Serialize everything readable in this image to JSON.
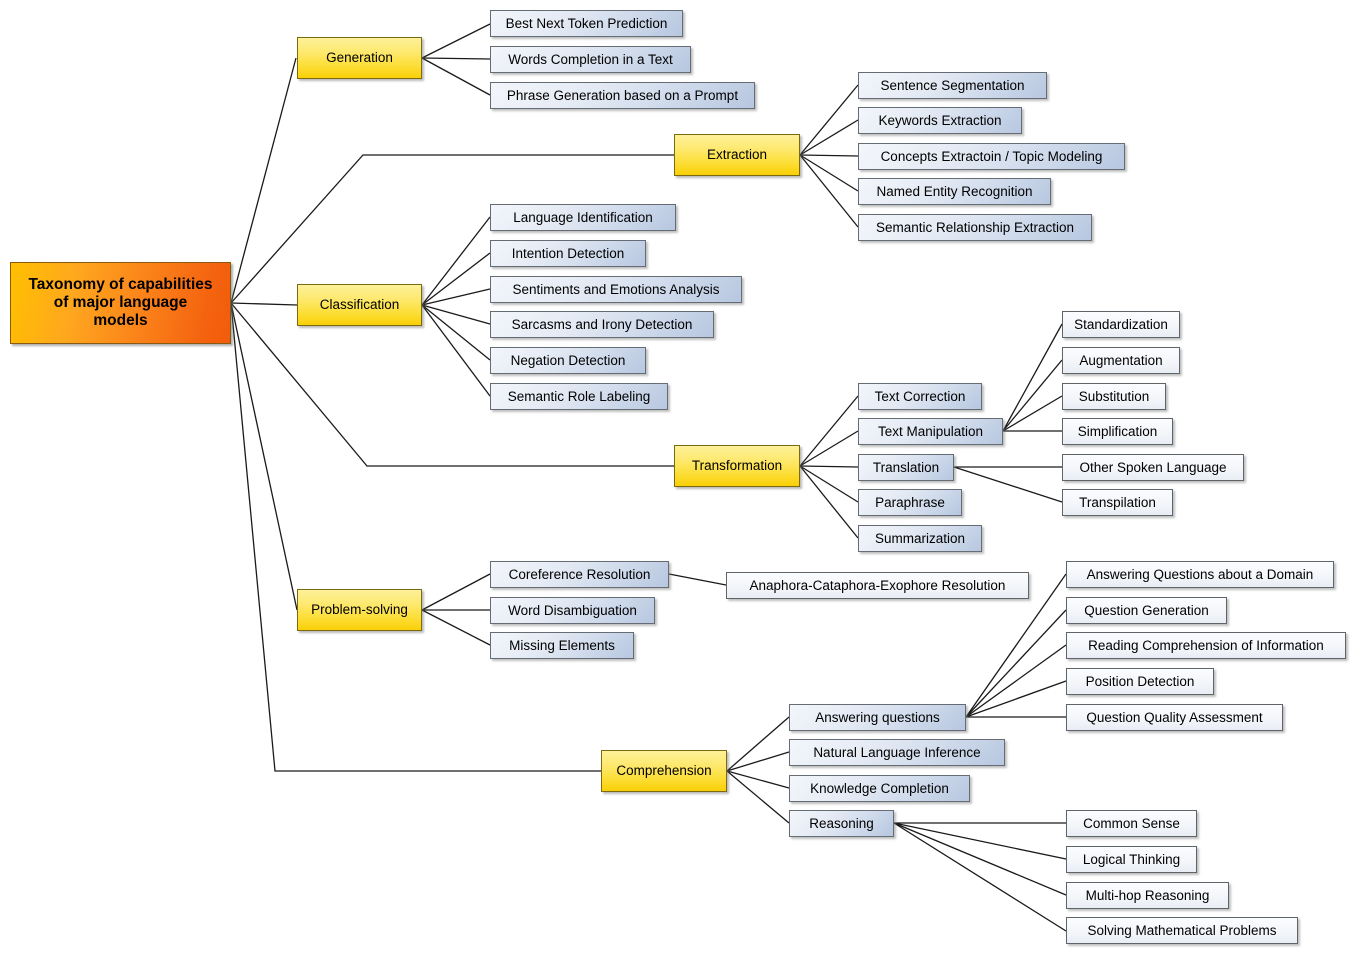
{
  "diagram": {
    "type": "mind-map",
    "title": "Taxonomy of capabilities of major language models",
    "background": "#ffffff",
    "colors": {
      "root_fill_left": "#ffc000",
      "root_fill_right": "#f25c0a",
      "category_fill": "#fcdc2e",
      "leaf_fill": "#ccd8ea",
      "sub_fill": "#f4f6fa",
      "edge": "#1a1a1a",
      "text": "#000000"
    }
  },
  "root": {
    "label": "Taxonomy of capabilities\nof major language\nmodels",
    "line1": "Taxonomy of capabilities",
    "line2": "of major language",
    "line3": "models"
  },
  "branches": [
    {
      "id": "generation",
      "label": "Generation",
      "children": [
        {
          "label": "Best Next Token Prediction"
        },
        {
          "label": "Words Completion in a Text"
        },
        {
          "label": "Phrase Generation based on a Prompt"
        }
      ]
    },
    {
      "id": "extraction",
      "label": "Extraction",
      "children": [
        {
          "label": "Sentence Segmentation"
        },
        {
          "label": "Keywords Extraction"
        },
        {
          "label": "Concepts Extractoin / Topic Modeling"
        },
        {
          "label": "Named Entity Recognition"
        },
        {
          "label": "Semantic Relationship Extraction"
        }
      ]
    },
    {
      "id": "classification",
      "label": "Classification",
      "children": [
        {
          "label": "Language Identification"
        },
        {
          "label": "Intention Detection"
        },
        {
          "label": "Sentiments and Emotions Analysis"
        },
        {
          "label": "Sarcasms and Irony Detection"
        },
        {
          "label": "Negation Detection"
        },
        {
          "label": "Semantic Role Labeling"
        }
      ]
    },
    {
      "id": "transformation",
      "label": "Transformation",
      "children": [
        {
          "label": "Text Correction"
        },
        {
          "label": "Text Manipulation",
          "children": [
            {
              "label": "Standardization"
            },
            {
              "label": "Augmentation"
            },
            {
              "label": "Substitution"
            },
            {
              "label": "Simplification"
            }
          ]
        },
        {
          "label": "Translation",
          "children": [
            {
              "label": "Other Spoken Language"
            },
            {
              "label": "Transpilation"
            }
          ]
        },
        {
          "label": "Paraphrase"
        },
        {
          "label": "Summarization"
        }
      ]
    },
    {
      "id": "problem-solving",
      "label": "Problem-solving",
      "children": [
        {
          "label": "Coreference Resolution",
          "children": [
            {
              "label": "Anaphora-Cataphora-Exophore Resolution"
            }
          ]
        },
        {
          "label": "Word Disambiguation"
        },
        {
          "label": "Missing Elements"
        }
      ]
    },
    {
      "id": "comprehension",
      "label": "Comprehension",
      "children": [
        {
          "label": "Answering questions",
          "children": [
            {
              "label": "Answering Questions about a Domain"
            },
            {
              "label": "Question Generation"
            },
            {
              "label": "Reading Comprehension of Information"
            },
            {
              "label": "Position Detection"
            },
            {
              "label": "Question Quality Assessment"
            }
          ]
        },
        {
          "label": "Natural Language Inference"
        },
        {
          "label": "Knowledge Completion"
        },
        {
          "label": "Reasoning",
          "children": [
            {
              "label": "Common Sense"
            },
            {
              "label": "Logical Thinking"
            },
            {
              "label": "Multi-hop Reasoning"
            },
            {
              "label": "Solving Mathematical Problems"
            }
          ]
        }
      ]
    }
  ]
}
